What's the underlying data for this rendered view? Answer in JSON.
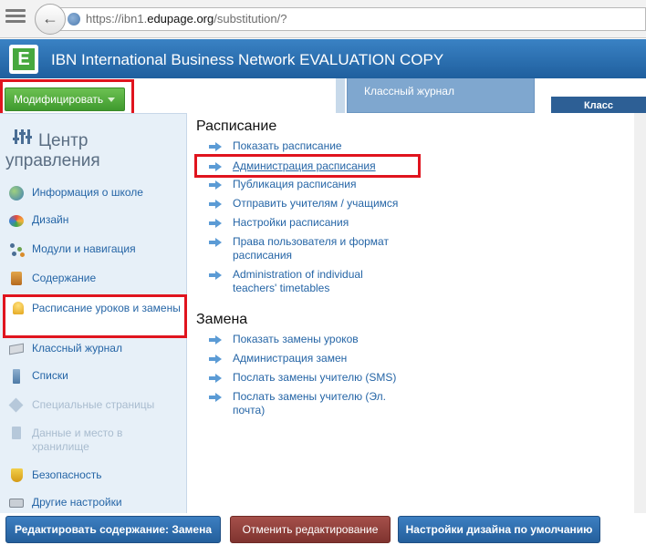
{
  "browser": {
    "url_prefix": "https://ibn1.",
    "url_domain": "edupage.org",
    "url_path": "/substitution/?"
  },
  "header": {
    "title": "IBN International Business Network EVALUATION COPY",
    "logo_letter": "E"
  },
  "toolbar": {
    "modify_label": "Модифицировать",
    "tab_journal": "Классный журнал",
    "tab_class": "Класс"
  },
  "sidebar": {
    "title_line1": "Центр",
    "title_line2": "управления",
    "items": [
      {
        "label": "Информация о школе",
        "icon": "globe-icon"
      },
      {
        "label": "Дизайн",
        "icon": "palette-icon"
      },
      {
        "label": "Модули и навигация",
        "icon": "modules-icon"
      },
      {
        "label": "Содержание",
        "icon": "content-icon"
      },
      {
        "label": "Расписание уроков и замены",
        "icon": "bell-icon"
      },
      {
        "label": "Классный журнал",
        "icon": "journal-icon"
      },
      {
        "label": "Списки",
        "icon": "list-icon"
      },
      {
        "label": "Специальные страницы",
        "icon": "special-pages-icon"
      },
      {
        "label": "Данные и место в хранилище",
        "icon": "storage-icon"
      },
      {
        "label": "Безопасность",
        "icon": "shield-icon"
      },
      {
        "label": "Другие настройки",
        "icon": "settings-icon"
      }
    ]
  },
  "main": {
    "section1_title": "Расписание",
    "section1_items": [
      "Показать расписание",
      "Администрация расписания",
      "Публикация расписания",
      "Отправить учителям / учащимся",
      "Настройки расписания",
      "Права пользователя и формат расписания",
      "Administration of individual teachers' timetables"
    ],
    "section2_title": "Замена",
    "section2_items": [
      "Показать замены уроков",
      "Администрация замен",
      "Послать замены учителю (SMS)",
      "Послать замены учителю (Эл. почта)"
    ]
  },
  "footer": {
    "edit_content": "Редактировать содержание: Замена",
    "cancel_edit": "Отменить редактирование",
    "default_design": "Настройки дизайна по умолчанию"
  },
  "colors": {
    "header_blue": "#2a6fb0",
    "link_blue": "#2565a6",
    "highlight_red": "#e0141e",
    "modify_green": "#4caa38"
  }
}
